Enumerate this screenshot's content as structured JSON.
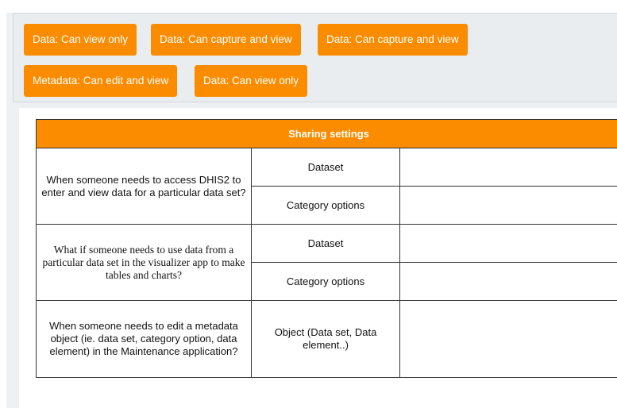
{
  "chips": [
    {
      "label": "Data: Can view only"
    },
    {
      "label": "Data: Can capture and view"
    },
    {
      "label": "Data: Can capture and view"
    },
    {
      "label": "Metadata: Can edit and view"
    },
    {
      "label": "Data: Can view only"
    }
  ],
  "table": {
    "header": "Sharing settings",
    "rows": [
      {
        "question": "When someone needs to access DHIS2 to enter and view data for a particular data set?",
        "objects": [
          "Dataset",
          "Category options"
        ],
        "answers": [
          "",
          ""
        ]
      },
      {
        "question": "What if someone needs to use data from a particular data set in the visualizer app to make tables and charts?",
        "objects": [
          "Dataset",
          "Category options"
        ],
        "answers": [
          "",
          ""
        ]
      },
      {
        "question": "When someone needs to edit a metadata object (ie. data set, category option, data element) in the Maintenance application?",
        "objects": [
          "Object (Data set, Data element..)"
        ],
        "answers": [
          ""
        ]
      }
    ]
  },
  "colors": {
    "accent": "#fb8c00",
    "panel_bg": "#e9edf0"
  }
}
